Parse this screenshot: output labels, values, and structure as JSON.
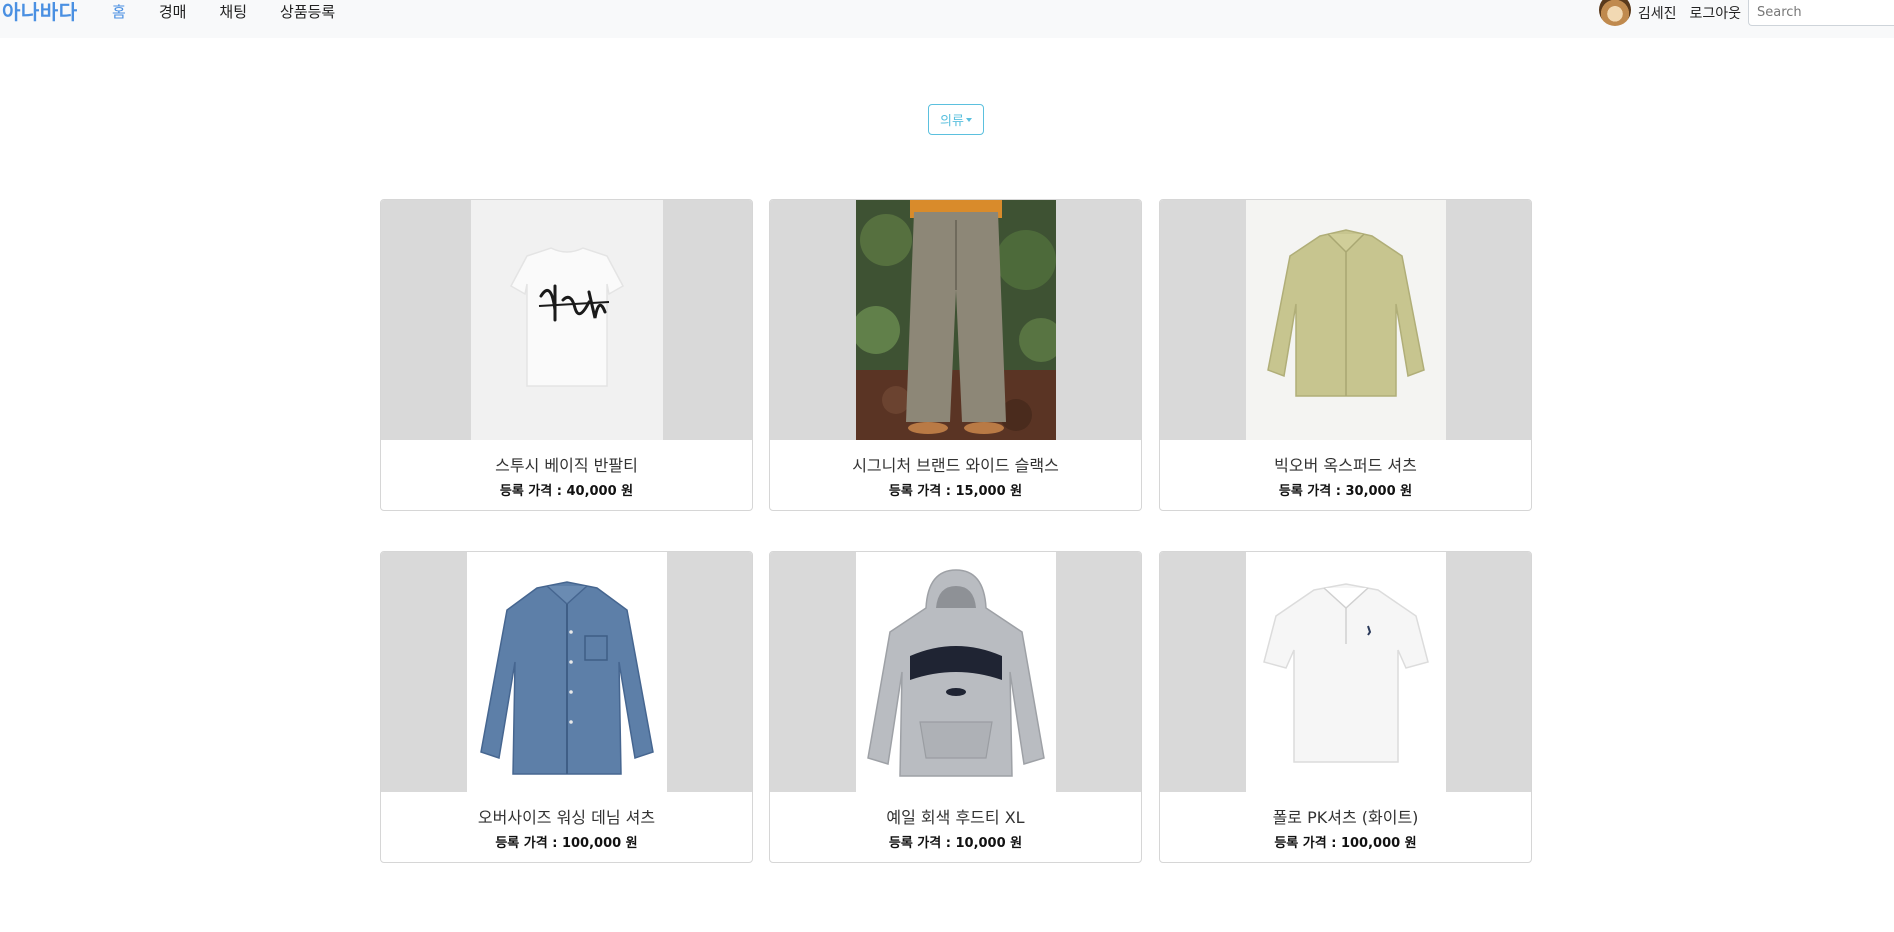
{
  "navbar": {
    "brand": "아나바다",
    "links": [
      "홈",
      "경매",
      "채팅",
      "상품등록"
    ],
    "user_name": "김세진",
    "logout_label": "로그아웃",
    "search_placeholder": "Search"
  },
  "filter": {
    "category_label": "의류"
  },
  "products": [
    {
      "title": "스투시 베이직 반팔티",
      "price": "등록 가격 : 40,000 원",
      "image": "white-graphic-tshirt"
    },
    {
      "title": "시그니처 브랜드 와이드 슬랙스",
      "price": "등록 가격 : 15,000 원",
      "image": "wide-slacks-model"
    },
    {
      "title": "빅오버 옥스퍼드 셔츠",
      "price": "등록 가격 : 30,000 원",
      "image": "olive-oxford-shirt"
    },
    {
      "title": "오버사이즈 워싱 데님 셔츠",
      "price": "등록 가격 : 100,000 원",
      "image": "denim-shirt"
    },
    {
      "title": "예일 회색 후드티 XL",
      "price": "등록 가격 : 10,000 원",
      "image": "grey-yale-hoodie"
    },
    {
      "title": "폴로 PK셔츠 (화이트)",
      "price": "등록 가격 : 100,000 원",
      "image": "white-polo-shirt"
    }
  ],
  "colors": {
    "brand": "#4a90e2",
    "dropdown": "#5bc0de",
    "card_image_bg": "#d9d9d9"
  }
}
